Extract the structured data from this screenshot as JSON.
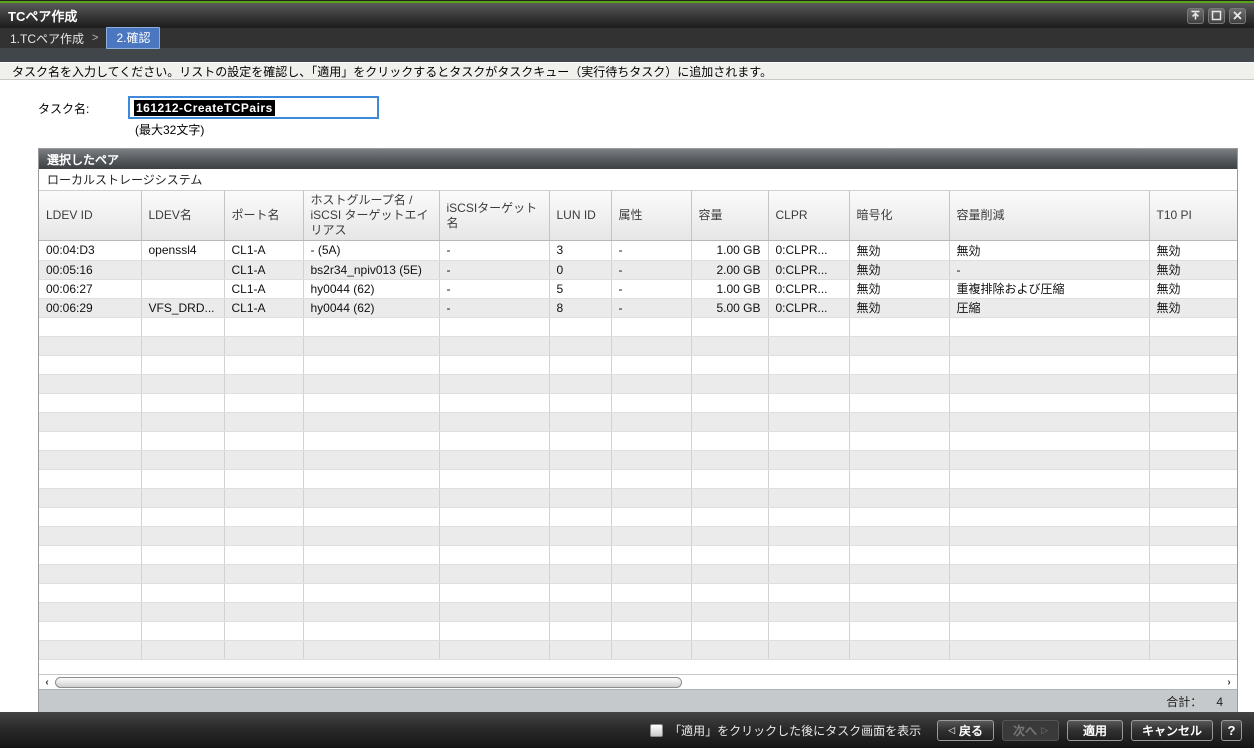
{
  "window": {
    "title": "TCペア作成",
    "controls": {
      "collapse": "collapse-window",
      "maximize": "maximize-window",
      "close": "close-window"
    }
  },
  "breadcrumb": {
    "step1": "1.TCペア作成",
    "separator": ">",
    "step2": "2.確認"
  },
  "instruction": "タスク名を入力してください。リストの設定を確認し、「適用」をクリックするとタスクがタスクキュー（実行待ちタスク）に追加されます。",
  "task": {
    "label": "タスク名:",
    "value": "161212-CreateTCPairs",
    "hint": "(最大32文字)"
  },
  "table": {
    "title": "選択したペア",
    "subtitle": "ローカルストレージシステム",
    "columns": [
      "LDEV ID",
      "LDEV名",
      "ポート名",
      "ホストグループ名 / iSCSI ターゲットエイリアス",
      "iSCSIターゲット名",
      "LUN ID",
      "属性",
      "容量",
      "CLPR",
      "暗号化",
      "容量削減",
      "T10 PI"
    ],
    "rows": [
      [
        "00:04:D3",
        "openssl4",
        "CL1-A",
        "- (5A)",
        "-",
        "3",
        "-",
        "1.00 GB",
        "0:CLPR...",
        "無効",
        "無効",
        "無効"
      ],
      [
        "00:05:16",
        "",
        "CL1-A",
        "bs2r34_npiv013 (5E)",
        "-",
        "0",
        "-",
        "2.00 GB",
        "0:CLPR...",
        "無効",
        "-",
        "無効"
      ],
      [
        "00:06:27",
        "",
        "CL1-A",
        "hy0044 (62)",
        "-",
        "5",
        "-",
        "1.00 GB",
        "0:CLPR...",
        "無効",
        "重複排除および圧縮",
        "無効"
      ],
      [
        "00:06:29",
        "VFS_DRD...",
        "CL1-A",
        "hy0044 (62)",
        "-",
        "8",
        "-",
        "5.00 GB",
        "0:CLPR...",
        "無効",
        "圧縮",
        "無効"
      ]
    ],
    "total_label": "合計：",
    "total_value": "4"
  },
  "footer": {
    "checkbox_label": "「適用」をクリックした後にタスク画面を表示",
    "back_label": "戻る",
    "back_arrow": "◁",
    "next_label": "次へ",
    "next_arrow": "▷",
    "apply_label": "適用",
    "cancel_label": "キャンセル",
    "help_label": "?"
  },
  "colors": {
    "accent_green": "#5aa317",
    "step_chip_blue": "#4a77c0",
    "input_border_blue": "#3f8ad8",
    "selection_bg": "#000000",
    "table_header_bar": "#3c4043",
    "footer_gray": "#c5c9cc"
  }
}
